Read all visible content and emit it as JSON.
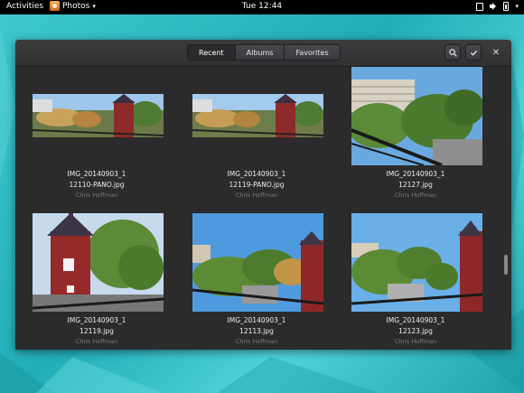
{
  "topbar": {
    "activities": "Activities",
    "app_name": "Photos",
    "clock": "Tue 12:44"
  },
  "header": {
    "tabs": [
      "Recent",
      "Albums",
      "Favorites"
    ],
    "active_tab": "Recent"
  },
  "photos": [
    {
      "title_line1": "IMG_20140903_1",
      "title_line2": "12110-PANO.jpg",
      "author": "Chris Hoffman"
    },
    {
      "title_line1": "IMG_20140903_1",
      "title_line2": "12119-PANO.jpg",
      "author": "Chris Hoffman"
    },
    {
      "title_line1": "IMG_20140903_1",
      "title_line2": "12127.jpg",
      "author": "Chris Hoffman"
    },
    {
      "title_line1": "IMG_20140903_1",
      "title_line2": "12119.jpg",
      "author": "Chris Hoffman"
    },
    {
      "title_line1": "IMG_20140903_1",
      "title_line2": "12113.jpg",
      "author": "Chris Hoffman"
    },
    {
      "title_line1": "IMG_20140903_1",
      "title_line2": "12123.jpg",
      "author": "Chris Hoffman"
    }
  ],
  "colors": {
    "desktop": "#2ab7c0",
    "window_bg": "#2b2b2c",
    "headerbar": "#353638"
  },
  "icons": [
    "photos-app-icon",
    "window-icon",
    "speaker-icon",
    "battery-icon",
    "search-icon",
    "checkmark-icon",
    "close-icon"
  ]
}
